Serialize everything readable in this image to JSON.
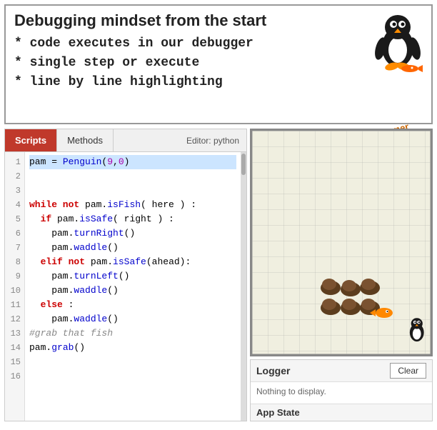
{
  "header": {
    "title": "Debugging mindset from the start",
    "points": [
      "code executes in our debugger",
      "single step or execute",
      "line by line highlighting"
    ],
    "think_text": "Think like a programmer"
  },
  "tabs": {
    "scripts_label": "Scripts",
    "methods_label": "Methods",
    "editor_label": "Editor: python"
  },
  "code": {
    "lines": [
      {
        "num": "1",
        "text": "pam = Penguin(9,0)",
        "highlight": true
      },
      {
        "num": "2",
        "text": ""
      },
      {
        "num": "3",
        "text": ""
      },
      {
        "num": "4",
        "text": "while not pam.isFish( here ) :"
      },
      {
        "num": "5",
        "text": "  if pam.isSafe( right ) :"
      },
      {
        "num": "6",
        "text": "    pam.turnRight()"
      },
      {
        "num": "7",
        "text": "    pam.waddle()"
      },
      {
        "num": "8",
        "text": "  elif not pam.isSafe(ahead):"
      },
      {
        "num": "9",
        "text": "    pam.turnLeft()"
      },
      {
        "num": "10",
        "text": "    pam.waddle()"
      },
      {
        "num": "11",
        "text": "  else :"
      },
      {
        "num": "12",
        "text": "    pam.waddle()"
      },
      {
        "num": "13",
        "text": "#grab that fish"
      },
      {
        "num": "14",
        "text": "pam.grab()"
      },
      {
        "num": "15",
        "text": ""
      },
      {
        "num": "16",
        "text": ""
      }
    ]
  },
  "logger": {
    "title": "Logger",
    "clear_label": "Clear",
    "content": "Nothing to display.",
    "app_state_label": "App State"
  },
  "colors": {
    "tab_active_bg": "#c0392b",
    "tab_active_text": "#ffffff",
    "highlight_line": "#cce5ff"
  }
}
